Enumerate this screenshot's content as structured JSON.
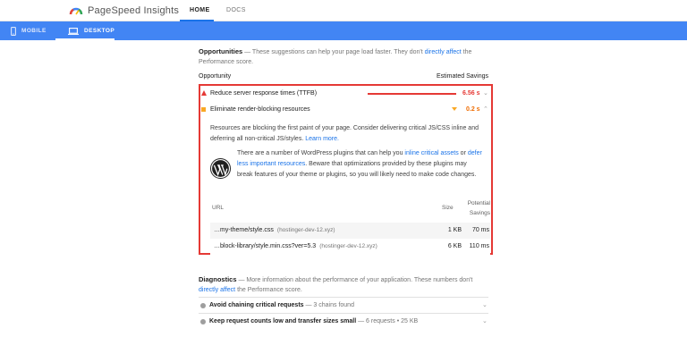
{
  "header": {
    "app_title": "PageSpeed Insights",
    "tabs": [
      {
        "label": "HOME",
        "active": true
      },
      {
        "label": "DOCS",
        "active": false
      }
    ]
  },
  "device_bar": {
    "tabs": [
      {
        "label": "MOBILE",
        "icon": "phone-icon",
        "active": false
      },
      {
        "label": "DESKTOP",
        "icon": "laptop-icon",
        "active": true
      }
    ],
    "color": "#4285f4"
  },
  "opportunities": {
    "title": "Opportunities",
    "desc_pre": " — These suggestions can help your page load faster. They don't ",
    "desc_link": "directly affect",
    "desc_post": " the Performance score.",
    "col_left": "Opportunity",
    "col_right": "Estimated Savings",
    "items": [
      {
        "label": "Reduce server response times (TTFB)",
        "value": "6.56 s",
        "status": "fail",
        "icon": "warning-triangle-icon",
        "color": "#e53935"
      },
      {
        "label": "Eliminate render-blocking resources",
        "value": "0.2 s",
        "status": "average",
        "icon": "orange-square-icon",
        "color": "#ef6c00"
      }
    ],
    "expanded": {
      "desc1": "Resources are blocking the first paint of your page. Consider delivering critical JS/CSS inline and deferring all non-critical JS/styles. ",
      "desc1_link": "Learn more.",
      "wp_pre": "There are a number of WordPress plugins that can help you ",
      "wp_link1": "inline critical assets",
      "wp_mid": " or ",
      "wp_link2": "defer less important resources",
      "wp_post": ". Beware that optimizations provided by these plugins may break features of your theme or plugins, so you will likely need to make code changes.",
      "table": {
        "col_url": "URL",
        "col_size": "Size",
        "col_savings": "Potential Savings",
        "rows": [
          {
            "url": "…my-theme/style.css",
            "host": "(hostinger-dev-12.xyz)",
            "size": "1 KB",
            "savings": "70 ms"
          },
          {
            "url": "…block-library/style.min.css?ver=5.3",
            "host": "(hostinger-dev-12.xyz)",
            "size": "6 KB",
            "savings": "110 ms"
          }
        ]
      }
    }
  },
  "diagnostics": {
    "title": "Diagnostics",
    "desc_pre": " — More information about the performance of your application. These numbers don't ",
    "desc_link": "directly affect",
    "desc_post": " the Performance score.",
    "items": [
      {
        "label": "Avoid chaining critical requests",
        "detail": " — 3 chains found"
      },
      {
        "label": "Keep request counts low and transfer sizes small",
        "detail": " — 6 requests • 25 KB"
      }
    ]
  }
}
